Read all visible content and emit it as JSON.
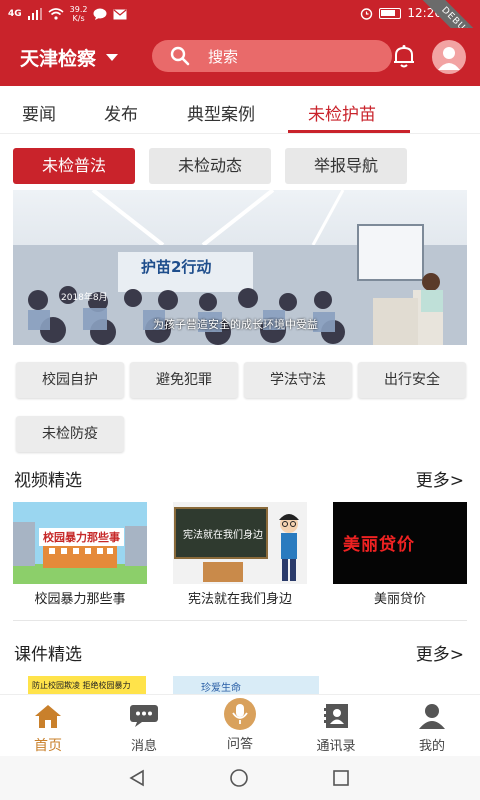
{
  "status_bar": {
    "signal": "4G",
    "speed": "39.2\nK/s",
    "speed_value": "39.2",
    "speed_unit": "K/s",
    "time": "12:26",
    "debug_label": "DEBUG"
  },
  "header": {
    "region": "天津检察",
    "search_placeholder": "搜索"
  },
  "tabs": [
    "要闻",
    "发布",
    "典型案例",
    "未检护苗"
  ],
  "sub_buttons": [
    "未检普法",
    "未检动态",
    "举报导航"
  ],
  "banner": {
    "brand": "护苗2行动",
    "caption": "为孩子营造安全的成长环境中受益",
    "sub": "2018年8月"
  },
  "tags": [
    "校园自护",
    "避免犯罪",
    "学法守法",
    "出行安全",
    "未检防疫"
  ],
  "video_section": {
    "title": "视频精选",
    "more": "更多>",
    "items": [
      {
        "caption": "校园暴力那些事",
        "thumb_text": "校园暴力那些事"
      },
      {
        "caption": "宪法就在我们身边",
        "thumb_text": "宪法就在我们身边"
      },
      {
        "caption": "美丽贷价",
        "thumb_text": "美丽贷价"
      }
    ]
  },
  "course_section": {
    "title": "课件精选",
    "more": "更多>",
    "items": [
      {
        "thumb_text": "防止校园欺凌 拒绝校园暴力"
      },
      {
        "thumb_text": "珍爱生命"
      }
    ]
  },
  "bottom_nav": [
    "首页",
    "消息",
    "问答",
    "通讯录",
    "我的"
  ],
  "colors": {
    "brand_red": "#c9232b",
    "active_nav": "#c9802b"
  }
}
